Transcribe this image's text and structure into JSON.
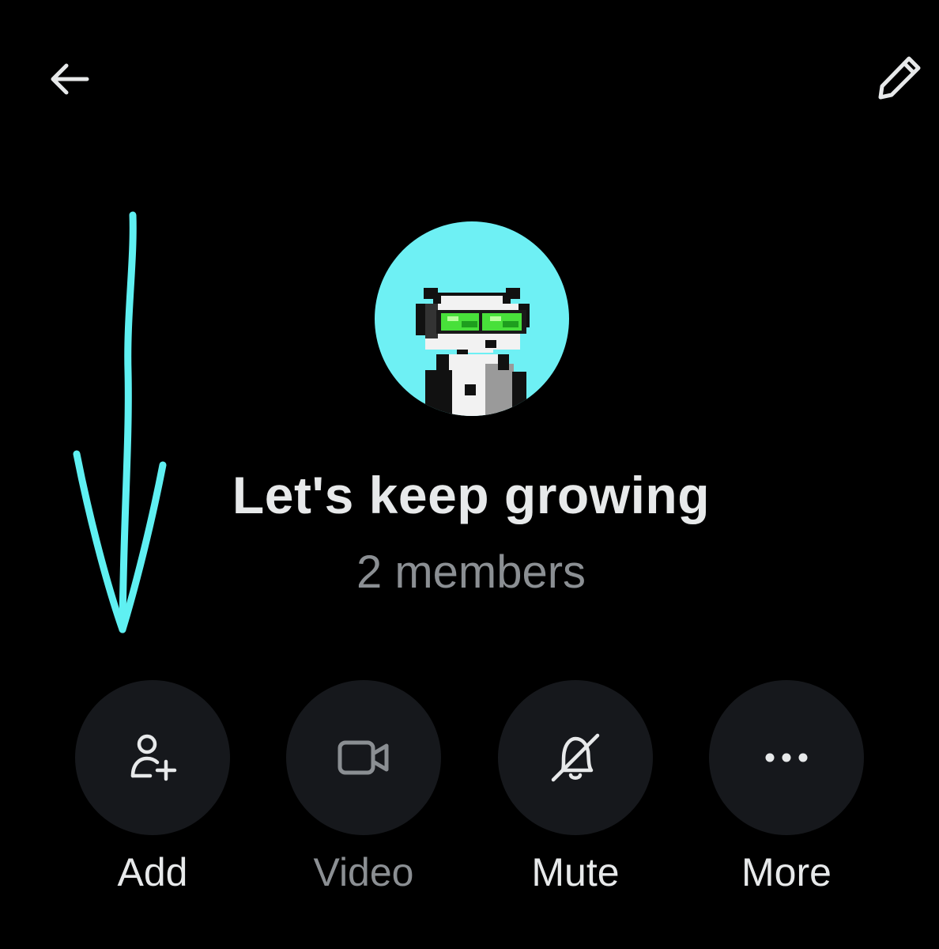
{
  "header": {
    "back_icon": "arrow-left-icon",
    "edit_icon": "pencil-icon"
  },
  "group": {
    "avatar_icon": "pixel-art-avatar",
    "name": "Let's keep growing",
    "members": "2 members"
  },
  "actions": [
    {
      "label": "Add",
      "icon": "add-person-icon",
      "enabled": true
    },
    {
      "label": "Video",
      "icon": "video-camera-icon",
      "enabled": false
    },
    {
      "label": "Mute",
      "icon": "bell-slash-icon",
      "enabled": true
    },
    {
      "label": "More",
      "icon": "more-dots-icon",
      "enabled": true
    }
  ],
  "colors": {
    "background": "#000000",
    "avatar_bg": "#6ef0f4",
    "annotation_arrow": "#5ff0f2",
    "button_bg": "#16181c",
    "primary_text": "#e7e9ea",
    "secondary_text": "#8b8f93"
  }
}
